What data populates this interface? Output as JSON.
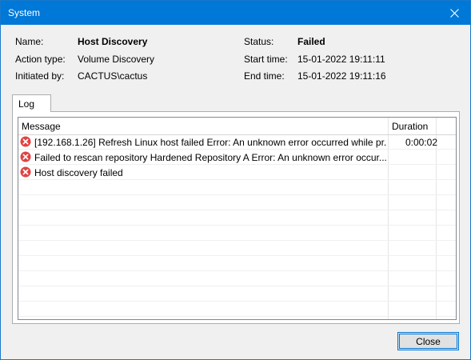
{
  "window": {
    "title": "System"
  },
  "info": {
    "name_label": "Name:",
    "name_value": "Host Discovery",
    "action_label": "Action type:",
    "action_value": "Volume Discovery",
    "initiated_label": "Initiated by:",
    "initiated_value": "CACTUS\\cactus",
    "status_label": "Status:",
    "status_value": "Failed",
    "start_label": "Start time:",
    "start_value": "15-01-2022 19:11:11",
    "end_label": "End time:",
    "end_value": "15-01-2022 19:11:16"
  },
  "tabs": [
    {
      "label": "Log"
    }
  ],
  "log": {
    "columns": {
      "message": "Message",
      "duration": "Duration"
    },
    "rows": [
      {
        "message": "[192.168.1.26] Refresh Linux host failed Error: An unknown error occurred while pr...",
        "duration": "0:00:02",
        "icon": "error-icon"
      },
      {
        "message": "Failed to rescan repository Hardened Repository A Error: An unknown error occur...",
        "duration": "",
        "icon": "error-icon"
      },
      {
        "message": "Host discovery failed",
        "duration": "",
        "icon": "error-icon"
      }
    ]
  },
  "buttons": {
    "close": "Close"
  },
  "colors": {
    "titlebar": "#0078d7",
    "error": "#e04343",
    "accent": "#0078d7"
  }
}
